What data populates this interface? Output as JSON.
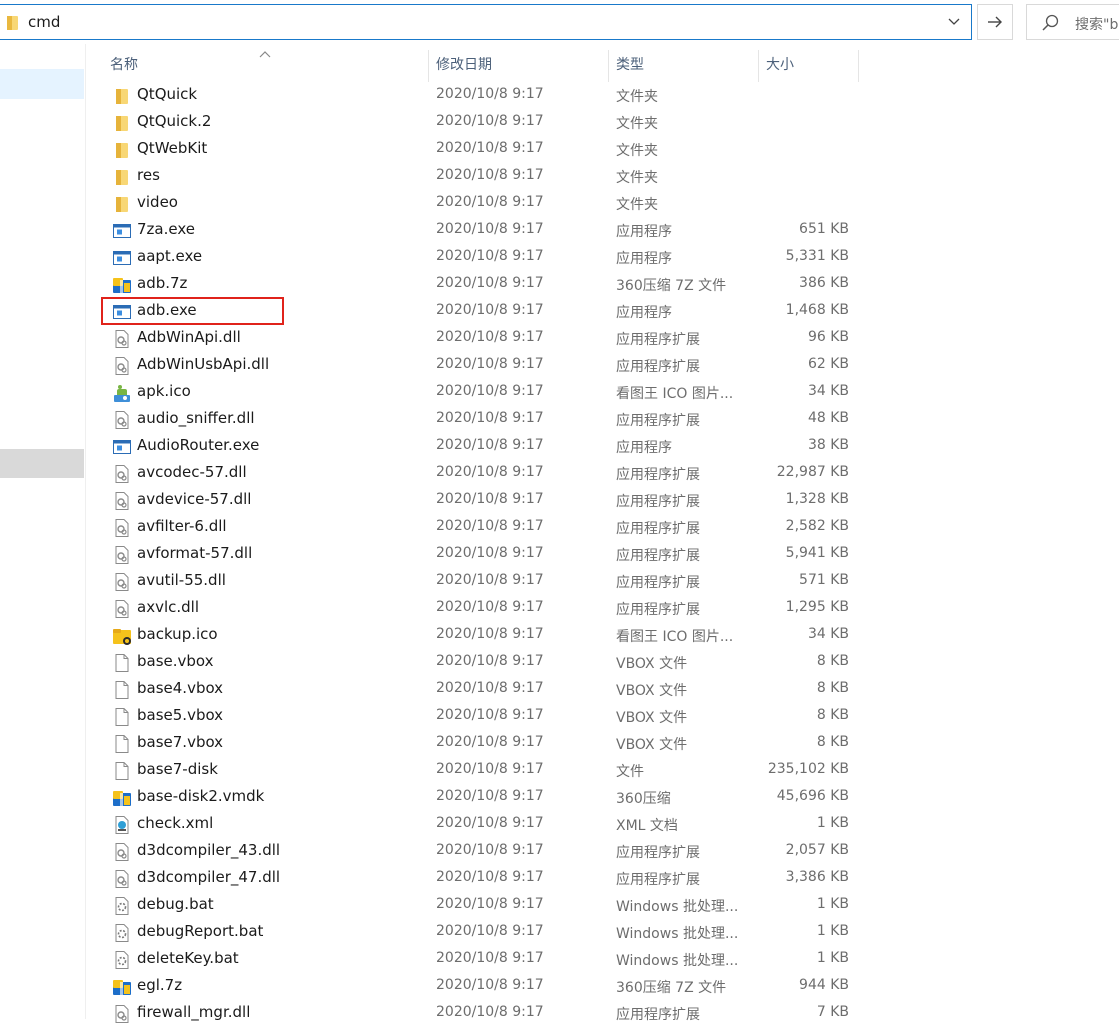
{
  "address": {
    "path": "cmd"
  },
  "search": {
    "placeholder": "搜索\"b"
  },
  "columns": {
    "name": "名称",
    "date": "修改日期",
    "type": "类型",
    "size": "大小"
  },
  "files": [
    {
      "name": "QtQuick",
      "date": "2020/10/8 9:17",
      "type": "文件夹",
      "size": "",
      "icon": "folder-icon"
    },
    {
      "name": "QtQuick.2",
      "date": "2020/10/8 9:17",
      "type": "文件夹",
      "size": "",
      "icon": "folder-icon"
    },
    {
      "name": "QtWebKit",
      "date": "2020/10/8 9:17",
      "type": "文件夹",
      "size": "",
      "icon": "folder-icon"
    },
    {
      "name": "res",
      "date": "2020/10/8 9:17",
      "type": "文件夹",
      "size": "",
      "icon": "folder-icon"
    },
    {
      "name": "video",
      "date": "2020/10/8 9:17",
      "type": "文件夹",
      "size": "",
      "icon": "folder-icon"
    },
    {
      "name": "7za.exe",
      "date": "2020/10/8 9:17",
      "type": "应用程序",
      "size": "651 KB",
      "icon": "exe-icon"
    },
    {
      "name": "aapt.exe",
      "date": "2020/10/8 9:17",
      "type": "应用程序",
      "size": "5,331 KB",
      "icon": "exe-icon"
    },
    {
      "name": "adb.7z",
      "date": "2020/10/8 9:17",
      "type": "360压缩 7Z 文件",
      "size": "386 KB",
      "icon": "archive-icon"
    },
    {
      "name": "adb.exe",
      "date": "2020/10/8 9:17",
      "type": "应用程序",
      "size": "1,468 KB",
      "icon": "exe-icon"
    },
    {
      "name": "AdbWinApi.dll",
      "date": "2020/10/8 9:17",
      "type": "应用程序扩展",
      "size": "96 KB",
      "icon": "dll-icon"
    },
    {
      "name": "AdbWinUsbApi.dll",
      "date": "2020/10/8 9:17",
      "type": "应用程序扩展",
      "size": "62 KB",
      "icon": "dll-icon"
    },
    {
      "name": "apk.ico",
      "date": "2020/10/8 9:17",
      "type": "看图王 ICO 图片...",
      "size": "34 KB",
      "icon": "apk-image-icon"
    },
    {
      "name": "audio_sniffer.dll",
      "date": "2020/10/8 9:17",
      "type": "应用程序扩展",
      "size": "48 KB",
      "icon": "dll-icon"
    },
    {
      "name": "AudioRouter.exe",
      "date": "2020/10/8 9:17",
      "type": "应用程序",
      "size": "38 KB",
      "icon": "exe-icon"
    },
    {
      "name": "avcodec-57.dll",
      "date": "2020/10/8 9:17",
      "type": "应用程序扩展",
      "size": "22,987 KB",
      "icon": "dll-icon"
    },
    {
      "name": "avdevice-57.dll",
      "date": "2020/10/8 9:17",
      "type": "应用程序扩展",
      "size": "1,328 KB",
      "icon": "dll-icon"
    },
    {
      "name": "avfilter-6.dll",
      "date": "2020/10/8 9:17",
      "type": "应用程序扩展",
      "size": "2,582 KB",
      "icon": "dll-icon"
    },
    {
      "name": "avformat-57.dll",
      "date": "2020/10/8 9:17",
      "type": "应用程序扩展",
      "size": "5,941 KB",
      "icon": "dll-icon"
    },
    {
      "name": "avutil-55.dll",
      "date": "2020/10/8 9:17",
      "type": "应用程序扩展",
      "size": "571 KB",
      "icon": "dll-icon"
    },
    {
      "name": "axvlc.dll",
      "date": "2020/10/8 9:17",
      "type": "应用程序扩展",
      "size": "1,295 KB",
      "icon": "dll-icon"
    },
    {
      "name": "backup.ico",
      "date": "2020/10/8 9:17",
      "type": "看图王 ICO 图片...",
      "size": "34 KB",
      "icon": "backup-image-icon"
    },
    {
      "name": "base.vbox",
      "date": "2020/10/8 9:17",
      "type": "VBOX 文件",
      "size": "8 KB",
      "icon": "blank-file-icon"
    },
    {
      "name": "base4.vbox",
      "date": "2020/10/8 9:17",
      "type": "VBOX 文件",
      "size": "8 KB",
      "icon": "blank-file-icon"
    },
    {
      "name": "base5.vbox",
      "date": "2020/10/8 9:17",
      "type": "VBOX 文件",
      "size": "8 KB",
      "icon": "blank-file-icon"
    },
    {
      "name": "base7.vbox",
      "date": "2020/10/8 9:17",
      "type": "VBOX 文件",
      "size": "8 KB",
      "icon": "blank-file-icon"
    },
    {
      "name": "base7-disk",
      "date": "2020/10/8 9:17",
      "type": "文件",
      "size": "235,102 KB",
      "icon": "blank-file-icon"
    },
    {
      "name": "base-disk2.vmdk",
      "date": "2020/10/8 9:17",
      "type": "360压缩",
      "size": "45,696 KB",
      "icon": "archive-icon"
    },
    {
      "name": "check.xml",
      "date": "2020/10/8 9:17",
      "type": "XML 文档",
      "size": "1 KB",
      "icon": "xml-icon"
    },
    {
      "name": "d3dcompiler_43.dll",
      "date": "2020/10/8 9:17",
      "type": "应用程序扩展",
      "size": "2,057 KB",
      "icon": "dll-icon"
    },
    {
      "name": "d3dcompiler_47.dll",
      "date": "2020/10/8 9:17",
      "type": "应用程序扩展",
      "size": "3,386 KB",
      "icon": "dll-icon"
    },
    {
      "name": "debug.bat",
      "date": "2020/10/8 9:17",
      "type": "Windows 批处理...",
      "size": "1 KB",
      "icon": "bat-icon"
    },
    {
      "name": "debugReport.bat",
      "date": "2020/10/8 9:17",
      "type": "Windows 批处理...",
      "size": "1 KB",
      "icon": "bat-icon"
    },
    {
      "name": "deleteKey.bat",
      "date": "2020/10/8 9:17",
      "type": "Windows 批处理...",
      "size": "1 KB",
      "icon": "bat-icon"
    },
    {
      "name": "egl.7z",
      "date": "2020/10/8 9:17",
      "type": "360压缩 7Z 文件",
      "size": "944 KB",
      "icon": "archive-icon"
    },
    {
      "name": "firewall_mgr.dll",
      "date": "2020/10/8 9:17",
      "type": "应用程序扩展",
      "size": "7 KB",
      "icon": "dll-icon"
    }
  ]
}
